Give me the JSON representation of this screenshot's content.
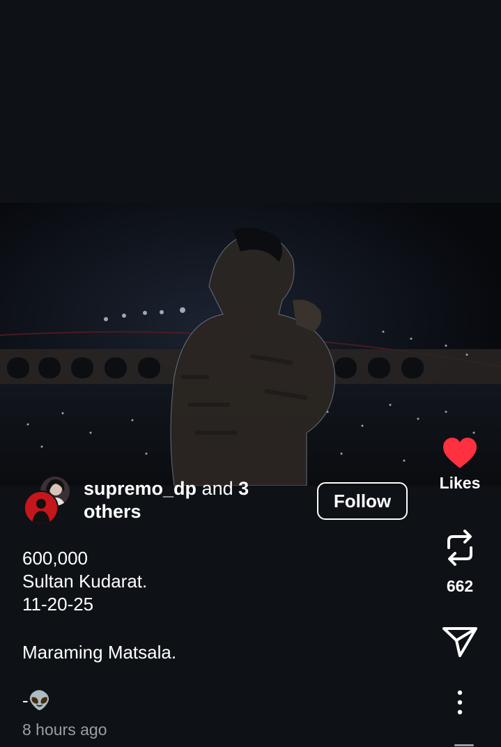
{
  "post": {
    "author_name": "supremo_dp",
    "author_joiner": "and",
    "author_others": "3 others",
    "follow_label": "Follow",
    "caption": {
      "line1": "600,000",
      "line2": "Sultan Kudarat.",
      "line3": "11-20-25",
      "line4": "Maraming Matsala.",
      "line5": "-👽"
    },
    "timestamp": "8 hours ago"
  },
  "actions": {
    "like": {
      "icon": "heart-icon",
      "label": "Likes",
      "color": "#ff3040"
    },
    "repost": {
      "icon": "repost-icon",
      "count": "662"
    },
    "share": {
      "icon": "send-icon"
    },
    "more": {
      "icon": "more-vertical-icon"
    }
  },
  "colors": {
    "background": "#0e1116",
    "text": "#ffffff",
    "muted": "#9a9fa8",
    "like": "#ff3040"
  }
}
